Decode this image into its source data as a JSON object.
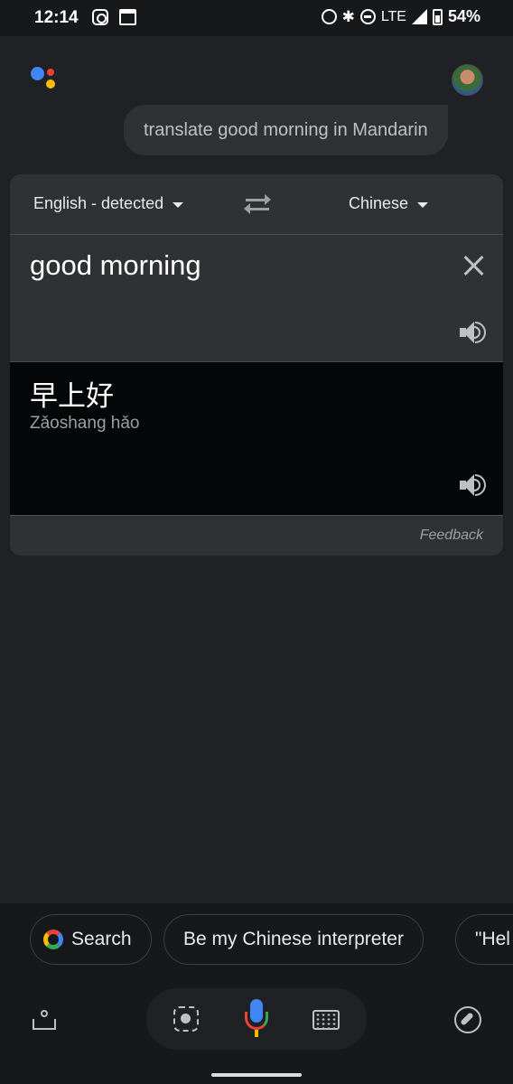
{
  "status_bar": {
    "time": "12:14",
    "network": "LTE",
    "battery": "54%",
    "icons": [
      "instagram-icon",
      "calendar-icon",
      "alarm-icon",
      "bluetooth-icon",
      "do-not-disturb-icon",
      "signal-icon",
      "battery-icon"
    ]
  },
  "assistant": {
    "query": "translate good morning in Mandarin"
  },
  "translate_card": {
    "source_language": "English - detected",
    "target_language": "Chinese",
    "source_text": "good morning",
    "translated_text": "早上好",
    "pinyin": "Zǎoshang hǎo",
    "feedback_label": "Feedback"
  },
  "suggestions": [
    {
      "label": "Search"
    },
    {
      "label": "Be my Chinese interpreter"
    },
    {
      "label": "\"Hel"
    }
  ],
  "bottom_bar": {
    "icons": [
      "updates-icon",
      "lens-icon",
      "mic-icon",
      "keyboard-icon",
      "explore-icon"
    ]
  },
  "colors": {
    "background": "#202124",
    "card": "#303134",
    "translation_panel": "#050607",
    "google_blue": "#4285f4",
    "google_red": "#ea4335",
    "google_yellow": "#fbbc04",
    "google_green": "#34a853"
  }
}
